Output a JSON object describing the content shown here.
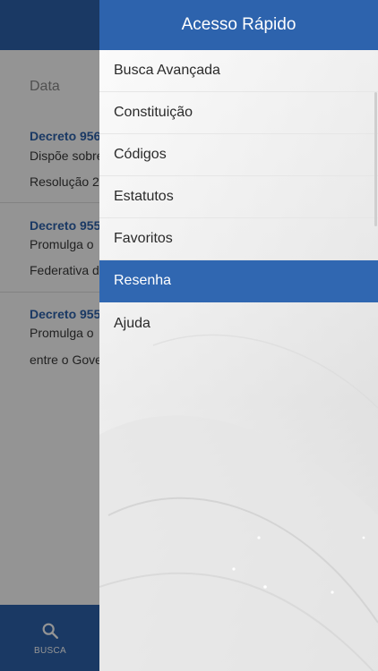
{
  "background": {
    "list_header": "Data",
    "items": [
      {
        "title": "Decreto 956",
        "line1": "Dispõe sobre",
        "line2": "Resolução 2"
      },
      {
        "title": "Decreto 955",
        "line1": "Promulga o",
        "line2": "Federativa d"
      },
      {
        "title": "Decreto 955",
        "line1": "Promulga o",
        "line2": "entre o Gove"
      }
    ],
    "bottom_tab": {
      "label": "BUSCA",
      "icon": "search-icon"
    }
  },
  "drawer": {
    "title": "Acesso Rápido",
    "items": [
      {
        "label": "Busca Avançada",
        "active": false
      },
      {
        "label": "Constituição",
        "active": false
      },
      {
        "label": "Códigos",
        "active": false
      },
      {
        "label": "Estatutos",
        "active": false
      },
      {
        "label": "Favoritos",
        "active": false
      },
      {
        "label": "Resenha",
        "active": true
      },
      {
        "label": "Ajuda",
        "active": false
      }
    ]
  },
  "colors": {
    "primary": "#2d63ad",
    "active_item": "#3067b1",
    "title_link": "#2d63ad"
  }
}
